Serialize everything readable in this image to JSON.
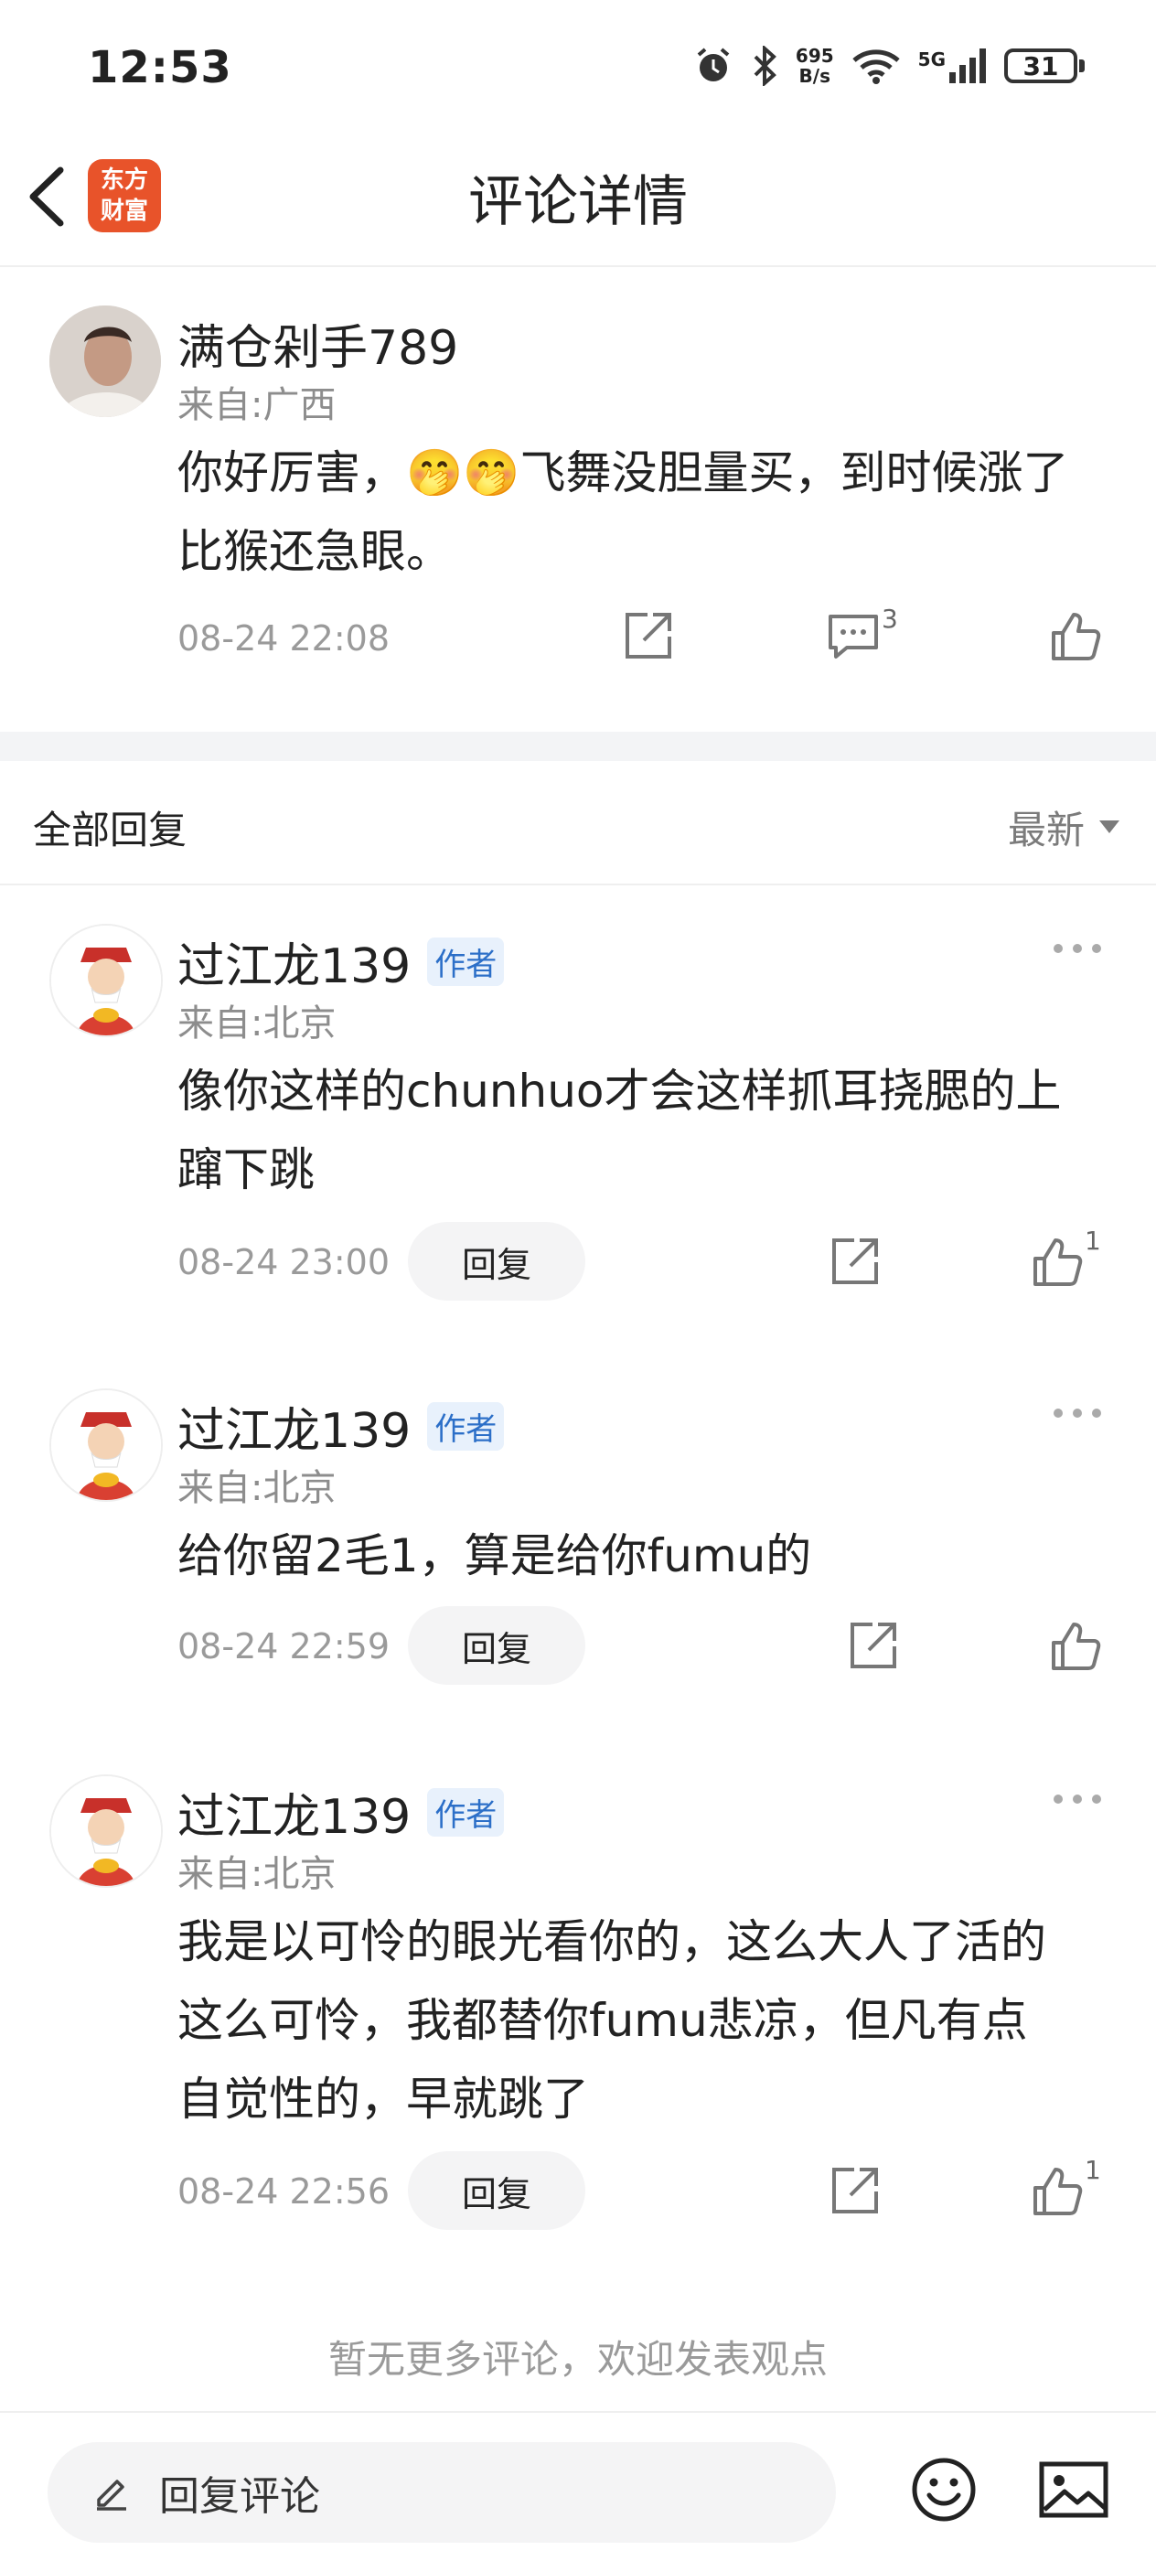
{
  "status_bar": {
    "time": "12:53",
    "net_speed_top": "695",
    "net_speed_bottom": "B/s",
    "signal_label": "5G",
    "battery": "31"
  },
  "header": {
    "logo_line1": "东方",
    "logo_line2": "财富",
    "title": "评论详情"
  },
  "main_comment": {
    "username": "满仓剁手789",
    "location": "来自:广西",
    "content_line1": "你好厉害，🤭🤭飞舞没胆量买，到时候涨了",
    "content_line2": "比猴还急眼。",
    "time": "08-24 22:08",
    "reply_count": "3"
  },
  "replies_header": {
    "title": "全部回复",
    "sort_label": "最新"
  },
  "replies": [
    {
      "username": "过江龙139",
      "badge": "作者",
      "location": "来自:北京",
      "lines": [
        "像你这样的chunhuo才会这样抓耳挠腮的上",
        "蹿下跳"
      ],
      "time": "08-24 23:00",
      "reply_label": "回复",
      "like_count": "1"
    },
    {
      "username": "过江龙139",
      "badge": "作者",
      "location": "来自:北京",
      "lines": [
        "给你留2毛1，算是给你fumu的"
      ],
      "time": "08-24 22:59",
      "reply_label": "回复",
      "like_count": ""
    },
    {
      "username": "过江龙139",
      "badge": "作者",
      "location": "来自:北京",
      "lines": [
        "我是以可怜的眼光看你的，这么大人了活的",
        "这么可怜，我都替你fumu悲凉，但凡有点",
        "自觉性的，早就跳了"
      ],
      "time": "08-24 22:56",
      "reply_label": "回复",
      "like_count": "1"
    }
  ],
  "footer": {
    "no_more_text": "暂无更多评论，欢迎发表观点"
  },
  "bottom_bar": {
    "reply_placeholder": "回复评论"
  },
  "icons": {
    "back": "chevron-left-icon",
    "share": "share-icon",
    "comment": "comment-icon",
    "like": "thumbs-up-icon",
    "more": "more-dots-icon",
    "emoji": "emoji-icon",
    "image": "image-icon",
    "edit": "pencil-icon"
  },
  "colors": {
    "brand": "#e8532a",
    "badge_bg": "#e8f1fc",
    "badge_text": "#2c6fc8"
  }
}
